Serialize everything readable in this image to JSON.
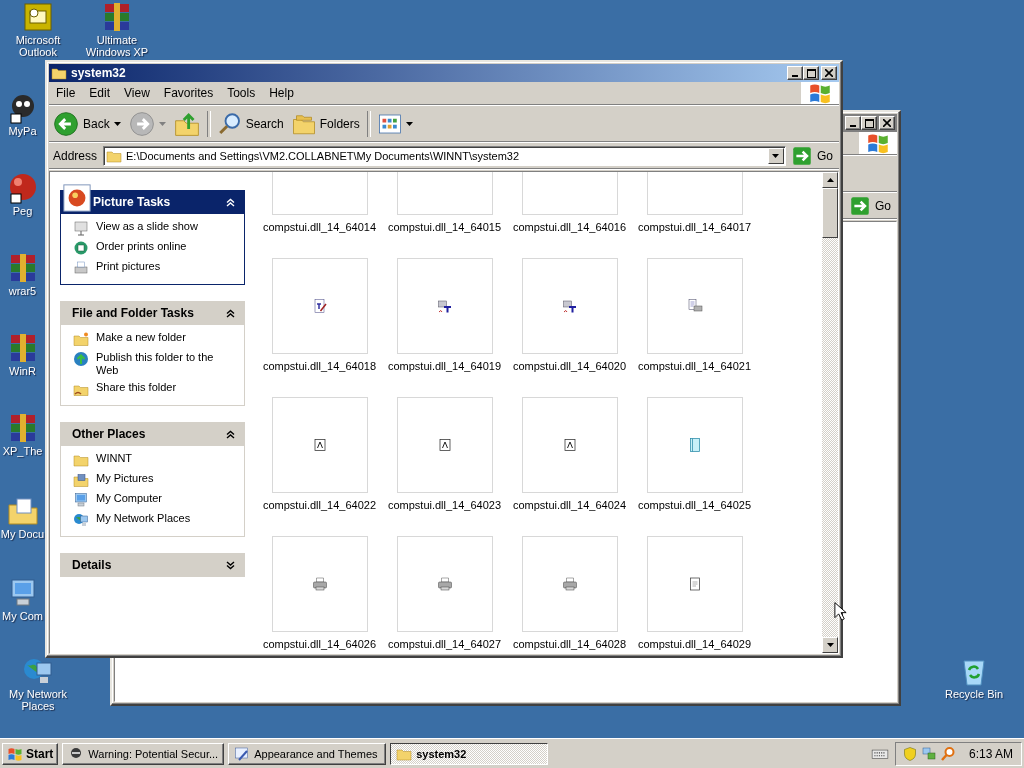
{
  "desktop_icons": [
    {
      "label": "Microsoft Outlook",
      "kind": "outlook"
    },
    {
      "label": "Ultimate Windows XP",
      "kind": "winrar"
    },
    {
      "label": "MyPa",
      "kind": "paint"
    },
    {
      "label": "Peg",
      "kind": "ball"
    },
    {
      "label": "wrar5",
      "kind": "winrar"
    },
    {
      "label": "WinR",
      "kind": "winrar"
    },
    {
      "label": "XP_The",
      "kind": "winrar"
    },
    {
      "label": "My Docu",
      "kind": "documents"
    },
    {
      "label": "My Com",
      "kind": "computer"
    },
    {
      "label": "My Network Places",
      "kind": "network"
    },
    {
      "label": "Recycle Bin",
      "kind": "recycle"
    }
  ],
  "back_window": {
    "go_button": "Go"
  },
  "window": {
    "title": "system32",
    "menu": [
      "File",
      "Edit",
      "View",
      "Favorites",
      "Tools",
      "Help"
    ],
    "toolbar": [
      {
        "label": "Back",
        "kind": "back",
        "disabled": false
      },
      {
        "kind": "forward",
        "disabled": true
      },
      {
        "kind": "up"
      },
      {
        "label": "Search",
        "kind": "search"
      },
      {
        "label": "Folders",
        "kind": "folders"
      },
      {
        "kind": "views"
      }
    ],
    "address": {
      "label": "Address",
      "value": "E:\\Documents and Settings\\VM2.COLLABNET\\My Documents\\WINNT\\system32",
      "go_button": "Go"
    },
    "task_sections": [
      {
        "title": "Picture Tasks",
        "kind": "primary",
        "expanded": true,
        "items": [
          {
            "label": "View as a slide show",
            "kind": "slideshow"
          },
          {
            "label": "Order prints online",
            "kind": "globe-print"
          },
          {
            "label": "Print pictures",
            "kind": "print"
          }
        ]
      },
      {
        "title": "File and Folder Tasks",
        "kind": "normal",
        "expanded": true,
        "items": [
          {
            "label": "Make a new folder",
            "kind": "new-folder"
          },
          {
            "label": "Publish this folder to the Web",
            "kind": "publish"
          },
          {
            "label": "Share this folder",
            "kind": "share"
          }
        ]
      },
      {
        "title": "Other Places",
        "kind": "normal",
        "expanded": true,
        "items": [
          {
            "label": "WINNT",
            "kind": "folder"
          },
          {
            "label": "My Pictures",
            "kind": "pictures"
          },
          {
            "label": "My Computer",
            "kind": "computer"
          },
          {
            "label": "My Network Places",
            "kind": "network"
          }
        ]
      },
      {
        "title": "Details",
        "kind": "normal",
        "expanded": false
      }
    ],
    "files": [
      {
        "name": "compstui.dll_14_64014"
      },
      {
        "name": "compstui.dll_14_64015"
      },
      {
        "name": "compstui.dll_14_64016"
      },
      {
        "name": "compstui.dll_14_64017"
      },
      {
        "name": "compstui.dll_14_64018",
        "kind": "font-edit"
      },
      {
        "name": "compstui.dll_14_64019",
        "kind": "printer-font"
      },
      {
        "name": "compstui.dll_14_64020",
        "kind": "printer-font"
      },
      {
        "name": "compstui.dll_14_64021",
        "kind": "doc-printer"
      },
      {
        "name": "compstui.dll_14_64022",
        "kind": "letter-page"
      },
      {
        "name": "compstui.dll_14_64023",
        "kind": "letter-page"
      },
      {
        "name": "compstui.dll_14_64024",
        "kind": "letter-page"
      },
      {
        "name": "compstui.dll_14_64025",
        "kind": "book"
      },
      {
        "name": "compstui.dll_14_64026",
        "kind": "printer"
      },
      {
        "name": "compstui.dll_14_64027",
        "kind": "printer"
      },
      {
        "name": "compstui.dll_14_64028",
        "kind": "printer"
      },
      {
        "name": "compstui.dll_14_64029",
        "kind": "page"
      }
    ]
  },
  "taskbar": {
    "start": "Start",
    "tasks": [
      {
        "label": "Warning: Potential Secur...",
        "kind": "warning",
        "selected": false
      },
      {
        "label": "Appearance and Themes",
        "kind": "appearance",
        "selected": false
      },
      {
        "label": "system32",
        "kind": "folder",
        "selected": true
      }
    ],
    "clock": "6:13 AM"
  }
}
